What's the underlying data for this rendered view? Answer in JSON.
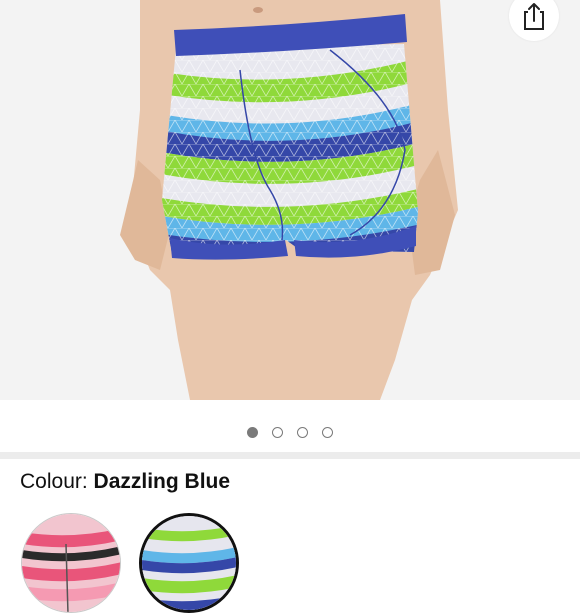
{
  "product": {
    "colour_label": "Colour:",
    "colour_value": "Dazzling Blue"
  },
  "gallery": {
    "image_count": 4,
    "active_index": 0
  },
  "swatches": [
    {
      "name": "pink-stripe",
      "selected": false
    },
    {
      "name": "dazzling-blue",
      "selected": true
    }
  ],
  "icons": {
    "share": "share-icon"
  },
  "colors": {
    "hero_bg": "#f3f3f3",
    "waistband": "#3f4fb8",
    "lime": "#8fd93a",
    "sky": "#5fb6e8",
    "royal": "#3547a8",
    "pink": "#e9557a"
  }
}
